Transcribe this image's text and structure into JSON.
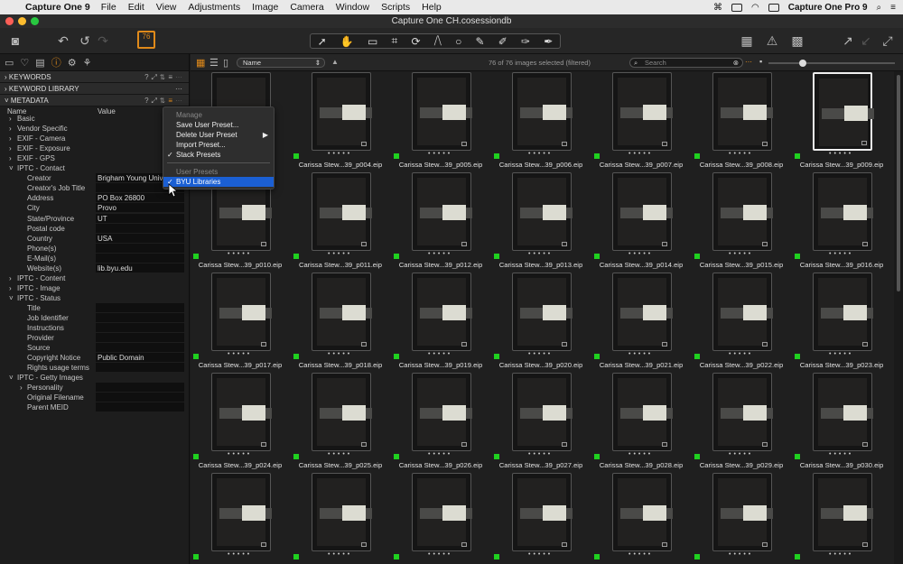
{
  "menubar": {
    "app": "Capture One 9",
    "items": [
      "File",
      "Edit",
      "View",
      "Adjustments",
      "Image",
      "Camera",
      "Window",
      "Scripts",
      "Help"
    ],
    "right_app": "Capture One Pro 9"
  },
  "window": {
    "title": "Capture One CH.cosessiondb"
  },
  "toolbar": {
    "badge": "76"
  },
  "left_panel": {
    "sections": [
      {
        "label": "KEYWORDS"
      },
      {
        "label": "KEYWORD LIBRARY"
      },
      {
        "label": "METADATA"
      }
    ],
    "col_name": "Name",
    "col_value": "Value",
    "rows": [
      {
        "kind": "group",
        "label": "Basic",
        "arrow": "›"
      },
      {
        "kind": "group",
        "label": "Vendor Specific",
        "arrow": "›"
      },
      {
        "kind": "group",
        "label": "EXIF - Camera",
        "arrow": "›"
      },
      {
        "kind": "group",
        "label": "EXIF - Exposure",
        "arrow": "›"
      },
      {
        "kind": "group",
        "label": "EXIF - GPS",
        "arrow": "›"
      },
      {
        "kind": "group",
        "label": "IPTC - Contact",
        "arrow": "˅"
      },
      {
        "kind": "field",
        "label": "Creator",
        "value": "Brigham Young Univ"
      },
      {
        "kind": "field",
        "label": "Creator's Job Title",
        "value": ""
      },
      {
        "kind": "field",
        "label": "Address",
        "value": "PO Box 26800"
      },
      {
        "kind": "field",
        "label": "City",
        "value": "Provo"
      },
      {
        "kind": "field",
        "label": "State/Province",
        "value": "UT"
      },
      {
        "kind": "field",
        "label": "Postal code",
        "value": ""
      },
      {
        "kind": "field",
        "label": "Country",
        "value": "USA"
      },
      {
        "kind": "field",
        "label": "Phone(s)",
        "value": ""
      },
      {
        "kind": "field",
        "label": "E-Mail(s)",
        "value": ""
      },
      {
        "kind": "field",
        "label": "Website(s)",
        "value": "lib.byu.edu"
      },
      {
        "kind": "group",
        "label": "IPTC - Content",
        "arrow": "›"
      },
      {
        "kind": "group",
        "label": "IPTC - Image",
        "arrow": "›"
      },
      {
        "kind": "group",
        "label": "IPTC - Status",
        "arrow": "˅"
      },
      {
        "kind": "field",
        "label": "Title",
        "value": ""
      },
      {
        "kind": "field",
        "label": "Job Identifier",
        "value": ""
      },
      {
        "kind": "field",
        "label": "Instructions",
        "value": ""
      },
      {
        "kind": "field",
        "label": "Provider",
        "value": ""
      },
      {
        "kind": "field",
        "label": "Source",
        "value": ""
      },
      {
        "kind": "field",
        "label": "Copyright Notice",
        "value": "Public Domain"
      },
      {
        "kind": "field",
        "label": "Rights usage terms",
        "value": ""
      },
      {
        "kind": "group",
        "label": "IPTC - Getty Images",
        "arrow": "˅"
      },
      {
        "kind": "sub",
        "label": "Personality",
        "value": ""
      },
      {
        "kind": "field",
        "label": "Original Filename",
        "value": ""
      },
      {
        "kind": "field",
        "label": "Parent MEID",
        "value": ""
      }
    ]
  },
  "popup": {
    "items": [
      {
        "label": "Manage",
        "disabled": true
      },
      {
        "label": "Save User Preset...",
        "disabled": false
      },
      {
        "label": "Delete User Preset",
        "disabled": false,
        "submenu": true
      },
      {
        "label": "Import Preset...",
        "disabled": false
      },
      {
        "label": "Stack Presets",
        "disabled": false,
        "checked": true
      },
      {
        "label": "User Presets",
        "disabled": true
      },
      {
        "label": "BYU Libraries",
        "disabled": false,
        "checked": true,
        "highlight": true
      }
    ]
  },
  "browser": {
    "sort": "Name",
    "selected": "76 of 76 images selected (filtered)",
    "search_placeholder": "Search",
    "thumbnails": [
      "",
      "Carissa Stew...39_p004.eip",
      "Carissa Stew...39_p005.eip",
      "Carissa Stew...39_p006.eip",
      "Carissa Stew...39_p007.eip",
      "Carissa Stew...39_p008.eip",
      "Carissa Stew...39_p009.eip",
      "Carissa Stew...39_p010.eip",
      "Carissa Stew...39_p011.eip",
      "Carissa Stew...39_p012.eip",
      "Carissa Stew...39_p013.eip",
      "Carissa Stew...39_p014.eip",
      "Carissa Stew...39_p015.eip",
      "Carissa Stew...39_p016.eip",
      "Carissa Stew...39_p017.eip",
      "Carissa Stew...39_p018.eip",
      "Carissa Stew...39_p019.eip",
      "Carissa Stew...39_p020.eip",
      "Carissa Stew...39_p021.eip",
      "Carissa Stew...39_p022.eip",
      "Carissa Stew...39_p023.eip",
      "Carissa Stew...39_p024.eip",
      "Carissa Stew...39_p025.eip",
      "Carissa Stew...39_p026.eip",
      "Carissa Stew...39_p027.eip",
      "Carissa Stew...39_p028.eip",
      "Carissa Stew...39_p029.eip",
      "Carissa Stew...39_p030.eip",
      "",
      "",
      "",
      "",
      "",
      "",
      ""
    ],
    "selected_index": 6
  },
  "colors": {
    "accent": "#e08a1a",
    "highlight": "#1b5fd3",
    "color_tag": "#1fd01f"
  }
}
